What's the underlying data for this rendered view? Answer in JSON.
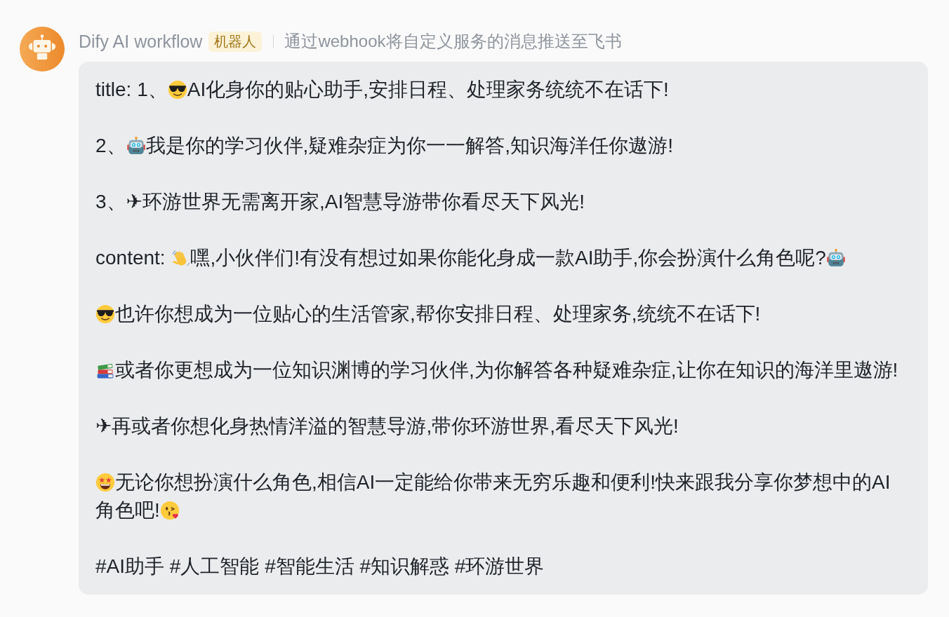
{
  "sender": {
    "name": "Dify AI workflow",
    "tag": "机器人",
    "description": "通过webhook将自定义服务的消息推送至飞书"
  },
  "message": {
    "paragraphs": [
      [
        {
          "kind": "text",
          "text": "title: 1、"
        },
        {
          "kind": "sunglasses"
        },
        {
          "kind": "text",
          "text": "AI化身你的贴心助手,安排日程、处理家务统统不在话下!"
        }
      ],
      [
        {
          "kind": "text",
          "text": "2、"
        },
        {
          "kind": "robot"
        },
        {
          "kind": "text",
          "text": "我是你的学习伙伴,疑难杂症为你一一解答,知识海洋任你遨游!"
        }
      ],
      [
        {
          "kind": "text",
          "text": "3、✈环游世界无需离开家,AI智慧导游带你看尽天下风光!"
        }
      ],
      [
        {
          "kind": "text",
          "text": "content: "
        },
        {
          "kind": "wave"
        },
        {
          "kind": "text",
          "text": "嘿,小伙伴们!有没有想过如果你能化身成一款AI助手,你会扮演什么角色呢?"
        },
        {
          "kind": "robot"
        }
      ],
      [
        {
          "kind": "sunglasses"
        },
        {
          "kind": "text",
          "text": "也许你想成为一位贴心的生活管家,帮你安排日程、处理家务,统统不在话下!"
        }
      ],
      [
        {
          "kind": "books"
        },
        {
          "kind": "text",
          "text": "或者你更想成为一位知识渊博的学习伙伴,为你解答各种疑难杂症,让你在知识的海洋里遨游!"
        }
      ],
      [
        {
          "kind": "text",
          "text": "✈再或者你想化身热情洋溢的智慧导游,带你环游世界,看尽天下风光!"
        }
      ],
      [
        {
          "kind": "starstruck"
        },
        {
          "kind": "text",
          "text": "无论你想扮演什么角色,相信AI一定能给你带来无穷乐趣和便利!快来跟我分享你梦想中的AI"
        },
        {
          "kind": "text",
          "text": "角色吧!"
        },
        {
          "kind": "kiss"
        }
      ],
      [
        {
          "kind": "text",
          "text": "#AI助手 #人工智能 #智能生活 #知识解惑 #环游世界"
        }
      ]
    ]
  }
}
